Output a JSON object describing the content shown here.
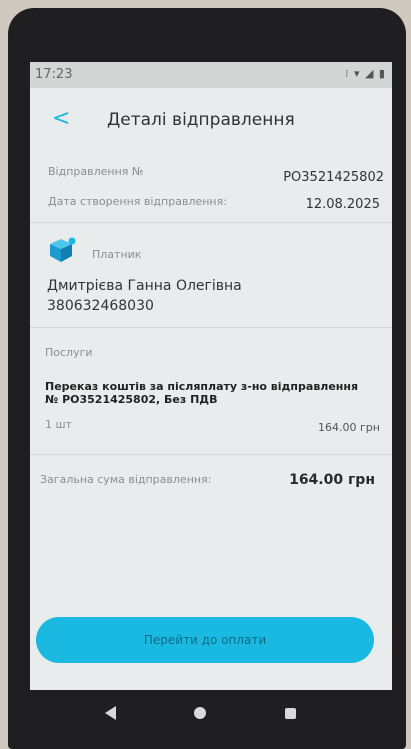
{
  "status": {
    "time": "17:23",
    "icons": "⁝ ▾ ◢ ▮"
  },
  "header": {
    "back_icon": "chevron-left-icon",
    "back_glyph": "<",
    "title": "Деталі відправлення"
  },
  "shipment": {
    "number_label": "Відправлення №",
    "number_value": "PO3521425802",
    "date_label": "Дата створення відправлення:",
    "date_value": "12.08.2025"
  },
  "payer": {
    "label": "Платник",
    "name": "Дмитрієва Ганна Олегівна",
    "phone": "380632468030",
    "icon": "package-box-icon"
  },
  "services": {
    "section_label": "Послуги",
    "items": [
      {
        "name": "Переказ коштів за післяплату з-но відправлення № PO3521425802, Без ПДВ",
        "qty": "1 шт",
        "price": "164.00 грн"
      }
    ]
  },
  "total": {
    "label": "Загальна сума відправлення:",
    "value": "164.00 грн"
  },
  "action": {
    "pay_label": "Перейти до оплати"
  },
  "colors": {
    "accent": "#19b9e1",
    "background": "#e9ecec",
    "device": "#1f1f21"
  }
}
